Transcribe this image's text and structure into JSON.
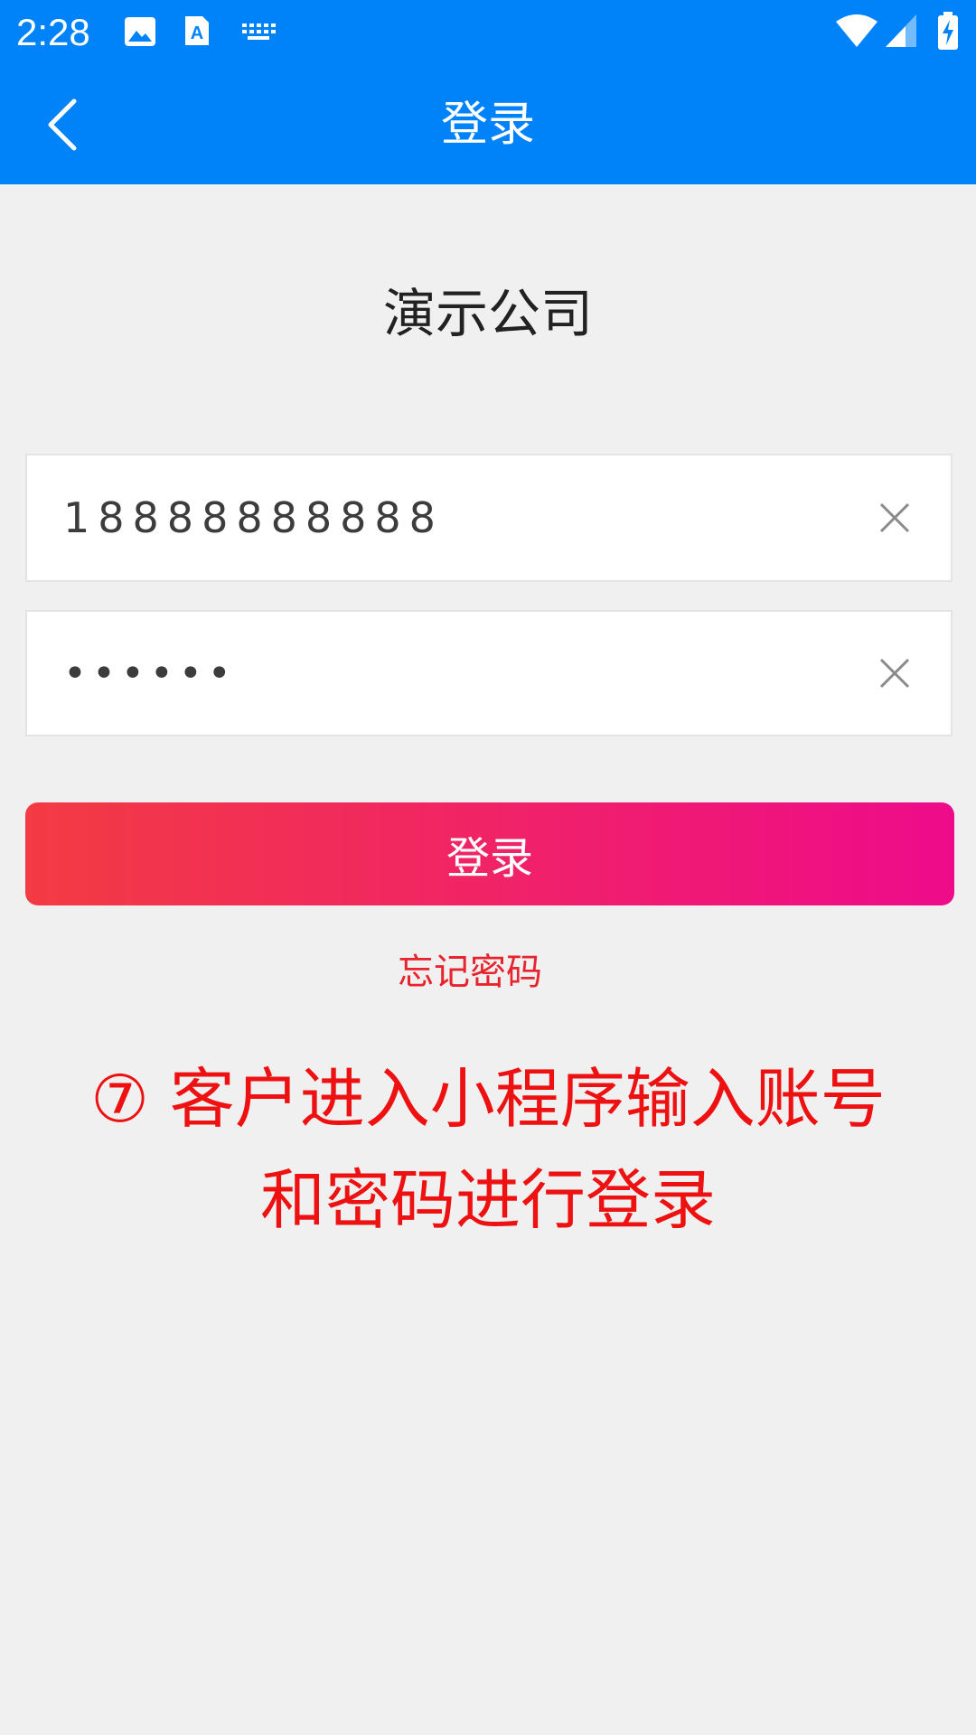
{
  "status_bar": {
    "time": "2:28",
    "icons": [
      "image-icon",
      "text-a-icon",
      "keyboard-icon",
      "wifi-icon",
      "signal-icon",
      "battery-charging-icon"
    ]
  },
  "nav": {
    "title": "登录",
    "back_icon": "chevron-left-icon"
  },
  "company_name": "演示公司",
  "form": {
    "phone_value": "18888888888",
    "password_value": "••••••",
    "clear_icon": "close-icon"
  },
  "login_button_label": "登录",
  "forgot_password_label": "忘记密码",
  "annotation": {
    "line1": "⑦ 客户进入小程序输入账号",
    "line2": "和密码进行登录"
  },
  "colors": {
    "header_blue": "#0083f9",
    "button_gradient_start": "#f33b43",
    "button_gradient_end": "#ee0b8a",
    "forgot_red": "#e8232d",
    "annotation_red": "#ee1111",
    "background": "#f0f0f0"
  }
}
